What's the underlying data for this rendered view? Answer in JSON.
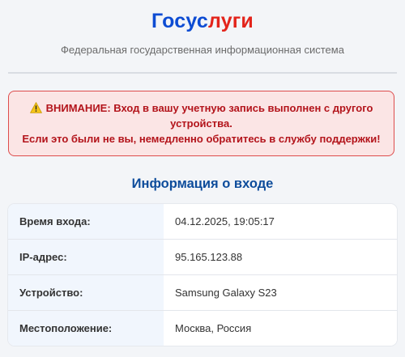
{
  "header": {
    "logo_part1": "Госус",
    "logo_part2": "луги",
    "subtitle": "Федеральная государственная информационная система"
  },
  "alert": {
    "icon": "warning-icon",
    "line1": "ВНИМАНИЕ: Вход в вашу учетную запись выполнен с другого",
    "line2": "устройства.",
    "line3": "Если это были не вы, немедленно обратитесь в службу поддержки!"
  },
  "login_info": {
    "title": "Информация о входе",
    "rows": [
      {
        "label": "Время входа:",
        "value": "04.12.2025, 19:05:17"
      },
      {
        "label": "IP-адрес:",
        "value": "95.165.123.88"
      },
      {
        "label": "Устройство:",
        "value": "Samsung Galaxy S23"
      },
      {
        "label": "Местоположение:",
        "value": "Москва, Россия"
      }
    ]
  },
  "colors": {
    "logo_blue": "#0d4cd3",
    "logo_red": "#e3241b",
    "alert_text": "#b3141b",
    "alert_border": "#dd4c4c",
    "alert_bg": "#fbe5e5",
    "section_title": "#0d4c9b",
    "label_bg": "#f1f6fd"
  }
}
